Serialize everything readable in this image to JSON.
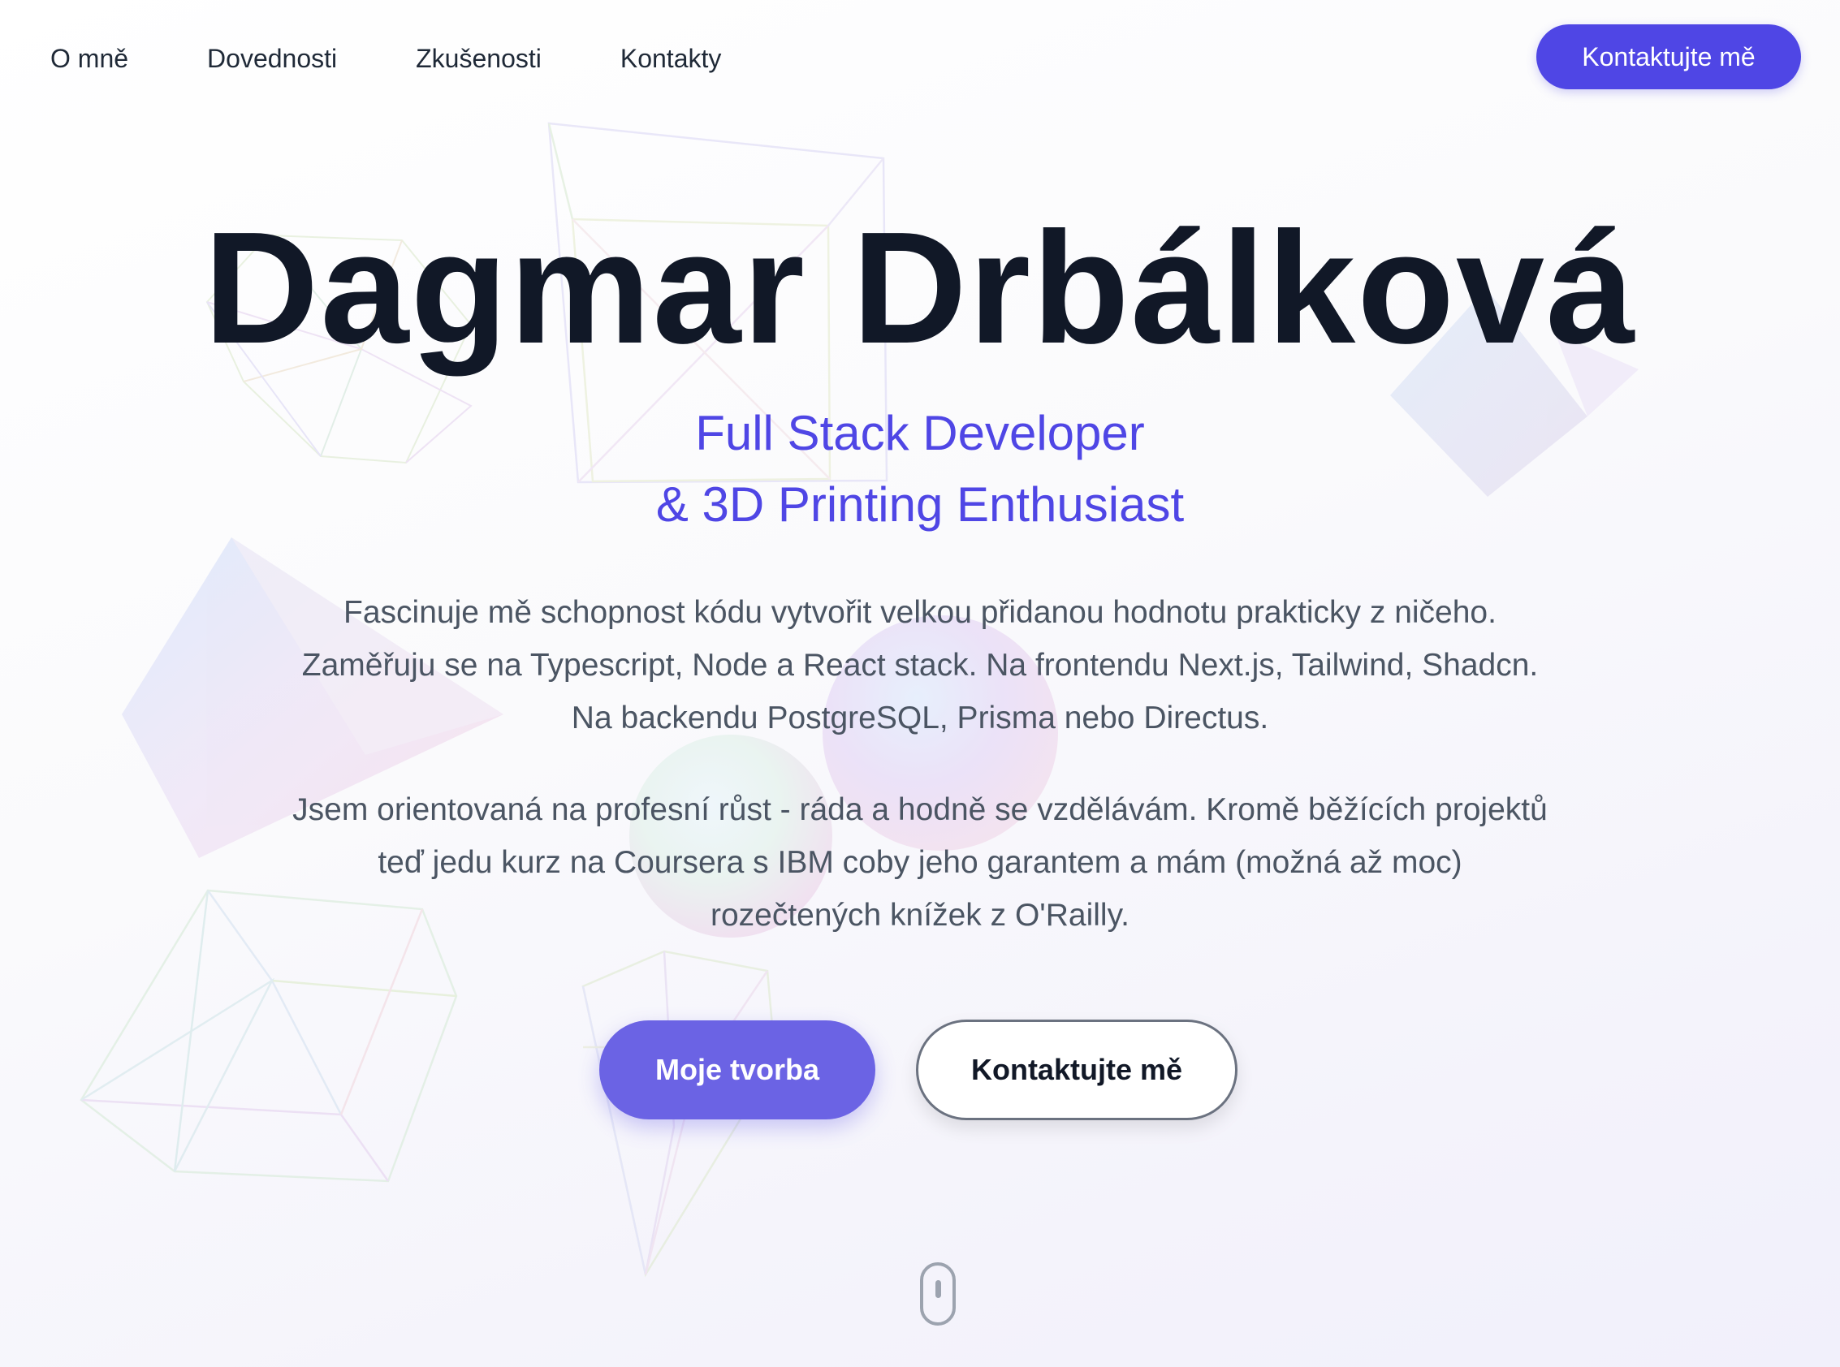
{
  "nav": {
    "links": [
      "O mně",
      "Dovednosti",
      "Zkušenosti",
      "Kontakty"
    ],
    "cta_label": "Kontaktujte mě"
  },
  "hero": {
    "name": "Dagmar Drbálková",
    "subtitle_line1": "Full Stack Developer",
    "subtitle_line2": "& 3D Printing Enthusiast",
    "paragraph1": "Fascinuje mě schopnost kódu vytvořit velkou přidanou hodnotu prakticky z niče­ho. Zaměřuju se na Typescript, Node a React stack. Na frontendu Next.js, Tailwind, Shadcn. Na backendu PostgreSQL, Prisma nebo Directus.",
    "paragraph2": "Jsem orientovaná na profesní růst - ráda a hodně se vzdělávám. Kromě běžících projektů teď jedu kurz na Coursera s IBM coby jeho garantem a mám (možná až moc) rozečtených knížek z O'Railly.",
    "primary_button": "Moje tvorba",
    "secondary_button": "Kontaktujte mě"
  },
  "colors": {
    "accent": "#4f46e5",
    "primary_button": "#6b63e4",
    "heading": "#111827",
    "body_text": "#4b5563"
  },
  "icons": {
    "scroll": "mouse-scroll-icon"
  }
}
